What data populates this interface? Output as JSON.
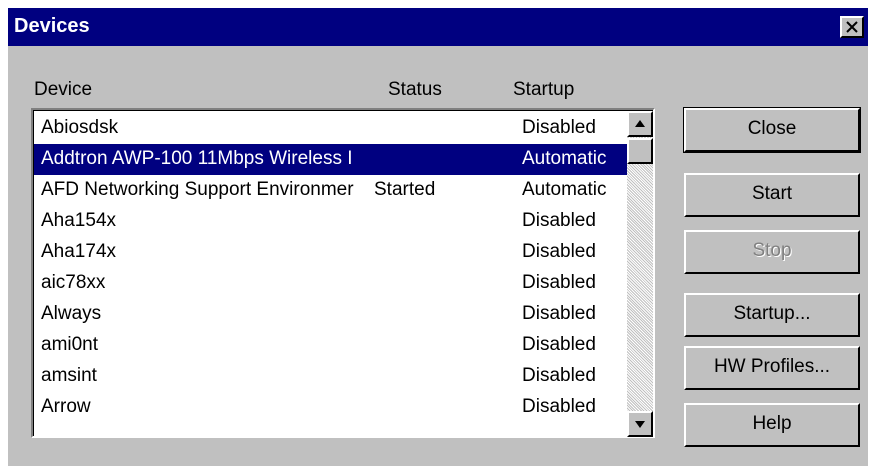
{
  "window": {
    "title": "Devices",
    "close_glyph": "×"
  },
  "columns": {
    "device": "Device",
    "status": "Status",
    "startup": "Startup"
  },
  "devices": [
    {
      "name": "Abiosdsk",
      "status": "",
      "startup": "Disabled",
      "selected": false
    },
    {
      "name": "Addtron AWP-100 11Mbps Wireless I",
      "status": "",
      "startup": "Automatic",
      "selected": true
    },
    {
      "name": "AFD Networking Support Environmer",
      "status": "Started",
      "startup": "Automatic",
      "selected": false
    },
    {
      "name": "Aha154x",
      "status": "",
      "startup": "Disabled",
      "selected": false
    },
    {
      "name": "Aha174x",
      "status": "",
      "startup": "Disabled",
      "selected": false
    },
    {
      "name": "aic78xx",
      "status": "",
      "startup": "Disabled",
      "selected": false
    },
    {
      "name": "Always",
      "status": "",
      "startup": "Disabled",
      "selected": false
    },
    {
      "name": "ami0nt",
      "status": "",
      "startup": "Disabled",
      "selected": false
    },
    {
      "name": "amsint",
      "status": "",
      "startup": "Disabled",
      "selected": false
    },
    {
      "name": "Arrow",
      "status": "",
      "startup": "Disabled",
      "selected": false
    }
  ],
  "buttons": {
    "close": "Close",
    "start": "Start",
    "stop": "Stop",
    "startup": "Startup...",
    "hw_profiles": "HW Profiles...",
    "help": "Help"
  },
  "colors": {
    "titlebar": "#000080",
    "face": "#c0c0c0",
    "selection": "#000080"
  }
}
